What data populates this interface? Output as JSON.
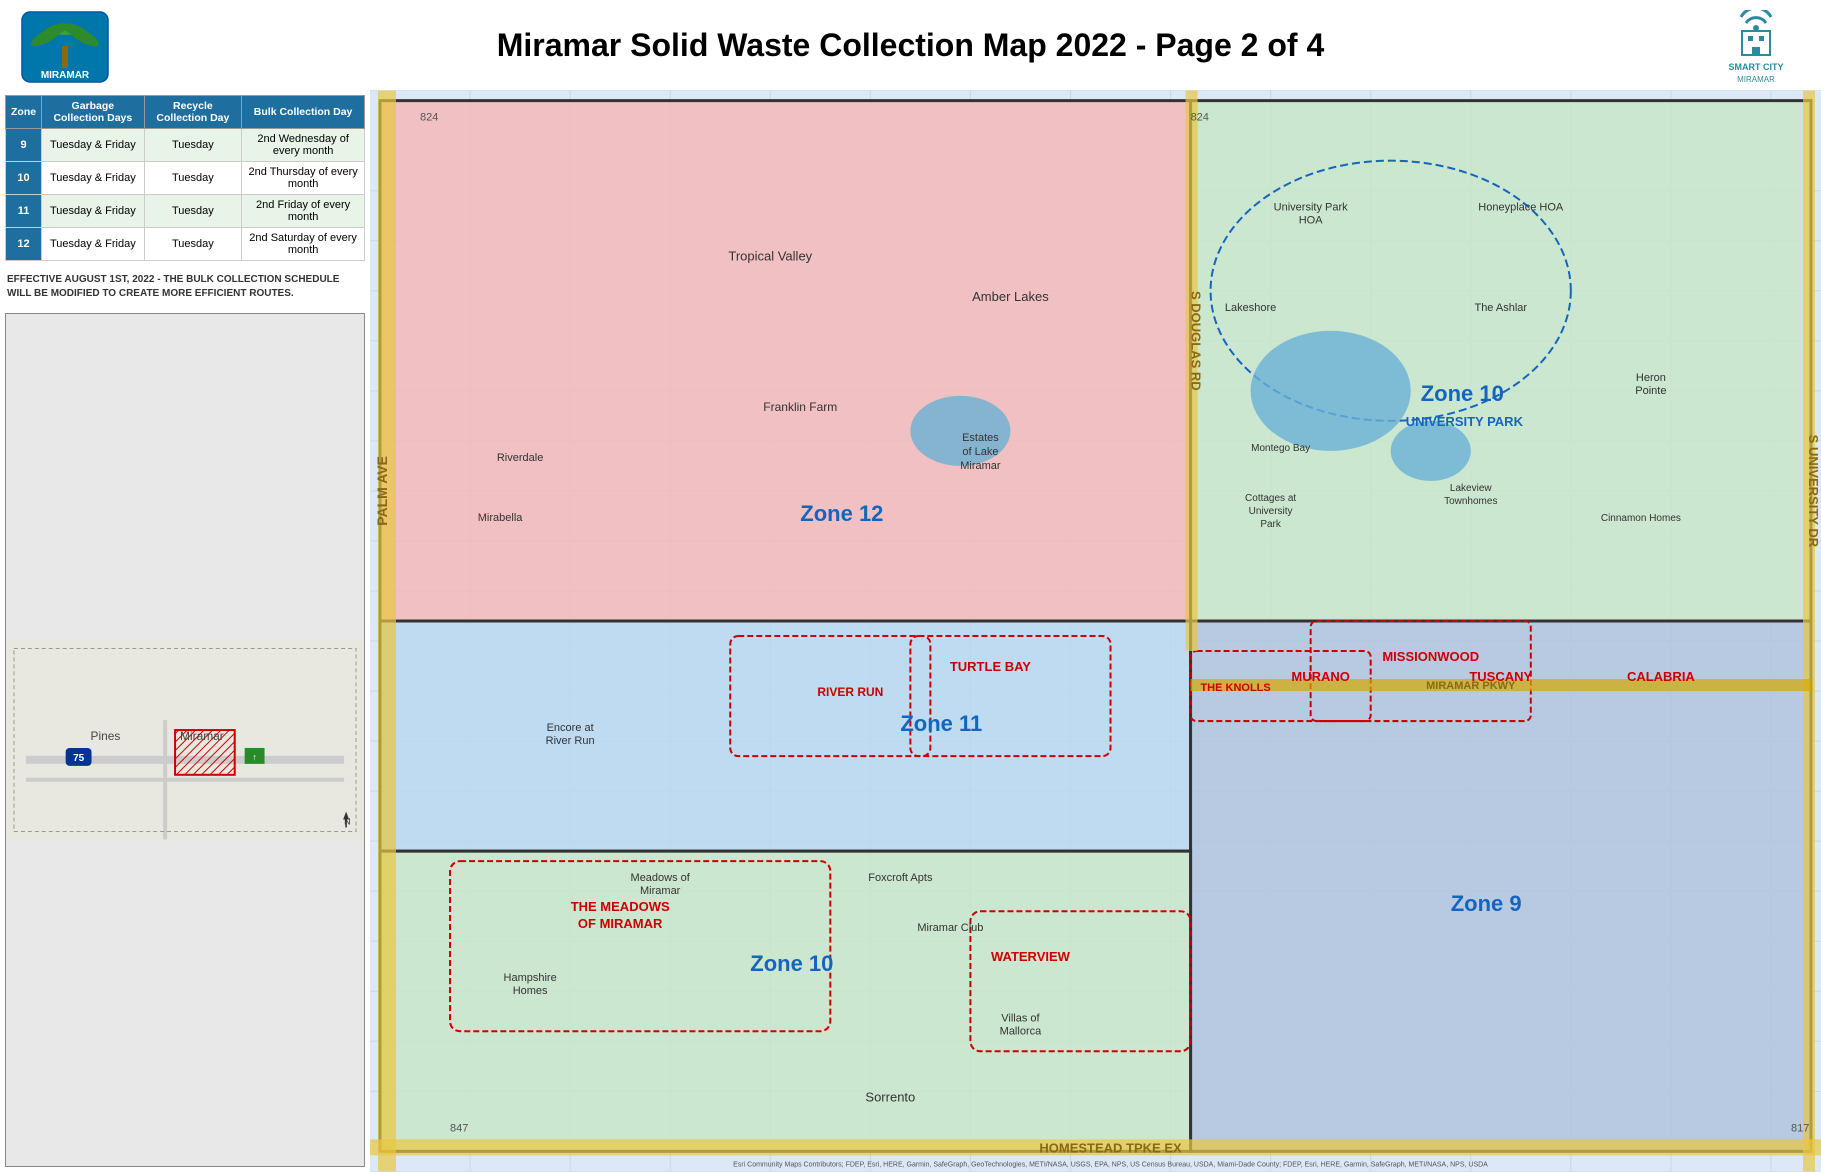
{
  "header": {
    "title": "Miramar Solid Waste Collection Map 2022 - Page 2 of 4",
    "logo_left_text": "MIRAMAR",
    "logo_right_title": "SMART CITY",
    "logo_right_sub": "MIRAMAR"
  },
  "table": {
    "headers": [
      "Zone",
      "Garbage Collection Days",
      "Recycle Collection Day",
      "Bulk Collection Day"
    ],
    "rows": [
      {
        "zone": "9",
        "garbage": "Tuesday & Friday",
        "recycle": "Tuesday",
        "bulk": "2nd Wednesday of every month"
      },
      {
        "zone": "10",
        "garbage": "Tuesday & Friday",
        "recycle": "Tuesday",
        "bulk": "2nd Thursday of every month"
      },
      {
        "zone": "11",
        "garbage": "Tuesday & Friday",
        "recycle": "Tuesday",
        "bulk": "2nd Friday of every month"
      },
      {
        "zone": "12",
        "garbage": "Tuesday & Friday",
        "recycle": "Tuesday",
        "bulk": "2nd Saturday of every month"
      }
    ]
  },
  "notice": "EFFECTIVE AUGUST 1ST, 2022 - THE BULK COLLECTION SCHEDULE WILL BE MODIFIED TO CREATE MORE EFFICIENT ROUTES.",
  "map": {
    "zones": [
      {
        "id": "zone9",
        "label": "Zone 9",
        "color": "#b0c4de"
      },
      {
        "id": "zone10_top",
        "label": "Zone 10",
        "sub": "UNIVERSITY PARK",
        "color": "#c8e6c9"
      },
      {
        "id": "zone10_bottom",
        "label": "Zone 10",
        "color": "#c8e6c9"
      },
      {
        "id": "zone11",
        "label": "Zone 11",
        "color": "#b0d4f0"
      },
      {
        "id": "zone12",
        "label": "Zone 12",
        "color": "#f4b8b8"
      }
    ],
    "neighborhoods": [
      "University Park HOA",
      "Honeyplace HOA",
      "Lakeshore",
      "The Ashlar",
      "Heron Pointe",
      "Montego Bay",
      "Lakeview Townhomes",
      "Cinnamon Homes",
      "Cottages at University Park",
      "MURANO",
      "TUSCANY",
      "CALABRIA",
      "MISSIONWOOD",
      "THE KNOLLS",
      "MIRAMAR PKWY",
      "Tropical Valley",
      "Amber Lakes",
      "Franklin Farm",
      "Estates of Lake Miramar",
      "Riverdale",
      "Mirabella",
      "TURTLE BAY",
      "RIVER RUN",
      "Encore at River Run",
      "THE MEADOWS OF MIRAMAR",
      "Meadows of Miramar",
      "Foxcroft Apts",
      "Miramar Club",
      "Hampshire Homes",
      "WATERVIEW",
      "Villas of Mallorca",
      "Sorrento"
    ],
    "roads": [
      "PALM AVE",
      "S DOUGLAS RD",
      "S UNIVERSITY DR",
      "HOMESTEAD TPKE EX",
      "MIRAMAR PKWY"
    ],
    "attribution": "Esri Community Maps Contributors; FDEP, Esri, HERE, Garmin, SafeGraph, GeoTechnologies, Inc, METI/NASA, USGS, EPA, NPS, US Census Bureau, USDA, Miami-Dade County; FDEP, Esri, HERE, Garmin, SafeGraph, METI/NASA, NPS, USDA"
  },
  "mini_map": {
    "places": [
      "Pines",
      "Miramar"
    ],
    "highway": "75"
  },
  "colors": {
    "zone9": "#b0c4de",
    "zone10": "#c8e6c9",
    "zone11": "#b0d4f0",
    "zone12": "#f4b8b8",
    "table_header": "#1e6fa0",
    "table_row_odd": "#e8f4e8"
  }
}
